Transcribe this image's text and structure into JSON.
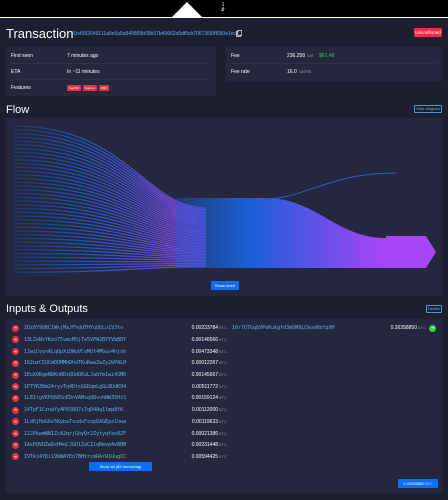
{
  "header": {
    "block_number": "1",
    "block_symbol": "⇵"
  },
  "transaction": {
    "title": "Transaction",
    "txid": "f1b4552649111a0e5a5a849809b09b37b49662a5df0cb70673f30ff050e1ec70",
    "status": "Unconfirmed",
    "first_seen_label": "First seen",
    "first_seen_value": "7 minutes ago",
    "eta_label": "ETA",
    "eta_value": "In ~11 minutes",
    "features_label": "Features",
    "features": [
      "SegWit",
      "Taproot",
      "RBF"
    ],
    "fee_label": "Fee",
    "fee_value": "236,258",
    "fee_unit": "sat",
    "fee_usd": "$61.48",
    "fee_rate_label": "Fee rate",
    "fee_rate_value": "16.0",
    "fee_rate_unit": "sat/vB"
  },
  "flow": {
    "title": "Flow",
    "hide_label": "Hide diagram",
    "show_more_label": "Show more",
    "gradient_start": "#1a5fd6",
    "gradient_end": "#a845f5"
  },
  "io": {
    "title": "Inputs & Outputs",
    "details_label": "Details",
    "inputs": [
      {
        "address": "1Dz8Y9QBC1WkjMaJFhddTHYuUbLv1VJtv",
        "amount": "0.00233784",
        "unit": "BTC"
      },
      {
        "address": "13LZeNsYKzo75vmcMSjTe5VPW2BYYVbBDY",
        "amount": "0.00146566",
        "unit": "BTC"
      },
      {
        "address": "1JwiCvynALqQpXiDWuVCvMUt4MGuv4hjoh",
        "amount": "0.00473348",
        "unit": "BTC"
      },
      {
        "address": "162uzC5QCmDDMMbDhdTKuKwwZwZy2bPALH",
        "amount": "0.00012267",
        "unit": "BTC"
      },
      {
        "address": "1EoXQKgeN8KnBDsQUdQEuLJabYm1wi4SMD",
        "amount": "0.00145667",
        "unit": "BTC"
      },
      {
        "address": "1P7YR38m24ryvTq4DtsGGDqmLgGL8UdK94",
        "amount": "0.00511772",
        "unit": "BTC"
      },
      {
        "address": "1LB1tgVKPQ6BSnEDnVAMsq98vvhNW35HiS",
        "amount": "0.00159124",
        "unit": "BTC"
      },
      {
        "address": "14TpF1CznaYy4P658Q7s7qD4Aq1lmp8f6",
        "amount": "0.00112000",
        "unit": "BTC"
      },
      {
        "address": "1Ld6jHaGGv5KpbaTsudxFsnpDAGEpz1hwa",
        "amount": "0.00119633",
        "unit": "BTC"
      },
      {
        "address": "122PkwmNN1ZcA2qrjGbyQr2ZytyqYao9ZF",
        "amount": "0.00021386",
        "unit": "BTC"
      },
      {
        "address": "1AxPQVUZw8xH4qCJGD1ZaCZiqRmvp4vBBM",
        "amount": "0.00231448",
        "unit": "BTC"
      },
      {
        "address": "19Tki4YBi19bWAYEn7BHtrcmRArR1UugCC",
        "amount": "0.00594425",
        "unit": "BTC"
      }
    ],
    "show_all_label": "Show all (89 remaining)",
    "output": {
      "address": "16r7U7GqbVPeKukgfd3mUN9LCkuoKbfpXM",
      "amount": "0.26358850",
      "unit": "BTC"
    },
    "total_amount": "0.26359850",
    "total_unit": "BTC"
  }
}
